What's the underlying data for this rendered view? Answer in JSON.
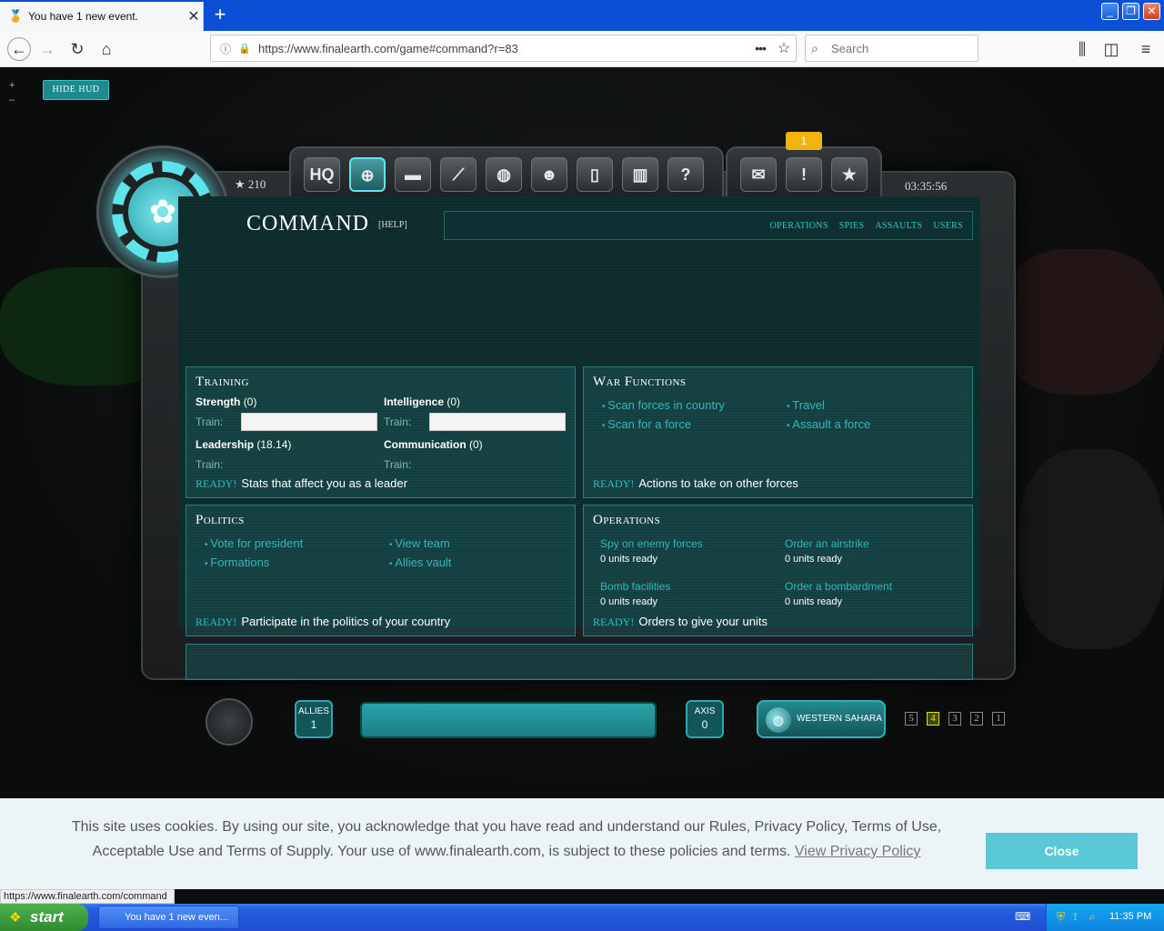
{
  "browser": {
    "tab_title": "You have 1 new event.",
    "url": "https://www.finalearth.com/game#command?r=83",
    "search_placeholder": "Search",
    "status_url": "https://www.finalearth.com/command"
  },
  "game": {
    "hide_hud": "HIDE HUD",
    "zoom_in": "+",
    "zoom_out": "–",
    "stars": "210",
    "clock": "03:35:56",
    "event_badge": "1",
    "icons": [
      "HQ",
      "target",
      "tank",
      "missile",
      "globe",
      "users",
      "podium",
      "stats",
      "help",
      "mail",
      "alert",
      "star"
    ],
    "page_title": "COMMAND",
    "help": "[HELP]",
    "subnav": [
      "OPERATIONS",
      "SPIES",
      "ASSAULTS",
      "USERS"
    ],
    "training": {
      "title": "Training",
      "strength_label": "Strength",
      "strength_val": "(0)",
      "intelligence_label": "Intelligence",
      "intelligence_val": "(0)",
      "leadership_label": "Leadership",
      "leadership_val": "(18.14)",
      "communication_label": "Communication",
      "communication_val": "(0)",
      "train": "Train:",
      "ready": "READY!",
      "ready_text": "Stats that affect you as a leader"
    },
    "war": {
      "title": "War Functions",
      "links": [
        "Scan forces in country",
        "Travel",
        "Scan for a force",
        "Assault a force"
      ],
      "ready": "READY!",
      "ready_text": "Actions to take on other forces"
    },
    "politics": {
      "title": "Politics",
      "links": [
        "Vote for president",
        "View team",
        "Formations",
        "Allies vault"
      ],
      "ready": "READY!",
      "ready_text": "Participate in the politics of your country"
    },
    "operations": {
      "title": "Operations",
      "items": [
        {
          "name": "Spy on enemy forces",
          "status": "0 units ready"
        },
        {
          "name": "Order an airstrike",
          "status": "0 units ready"
        },
        {
          "name": "Bomb facilities",
          "status": "0 units ready"
        },
        {
          "name": "Order a bombardment",
          "status": "0 units ready"
        }
      ],
      "ready": "READY!",
      "ready_text": "Orders to give your units"
    },
    "allies_label": "ALLIES",
    "allies_count": "1",
    "axis_label": "AXIS",
    "axis_count": "0",
    "region": "WESTERN SAHARA",
    "levels": [
      "5",
      "4",
      "3",
      "2",
      "1"
    ],
    "active_level": "4"
  },
  "cookie": {
    "text": "This site uses cookies. By using our site, you acknowledge that you have read and understand our Rules, Privacy Policy, Terms of Use, Acceptable Use and Terms of Supply. Your use of www.finalearth.com, is subject to these policies and terms.",
    "link": "View Privacy Policy",
    "close": "Close"
  },
  "taskbar": {
    "start": "start",
    "task": "You have 1 new even...",
    "time": "11:35 PM"
  }
}
